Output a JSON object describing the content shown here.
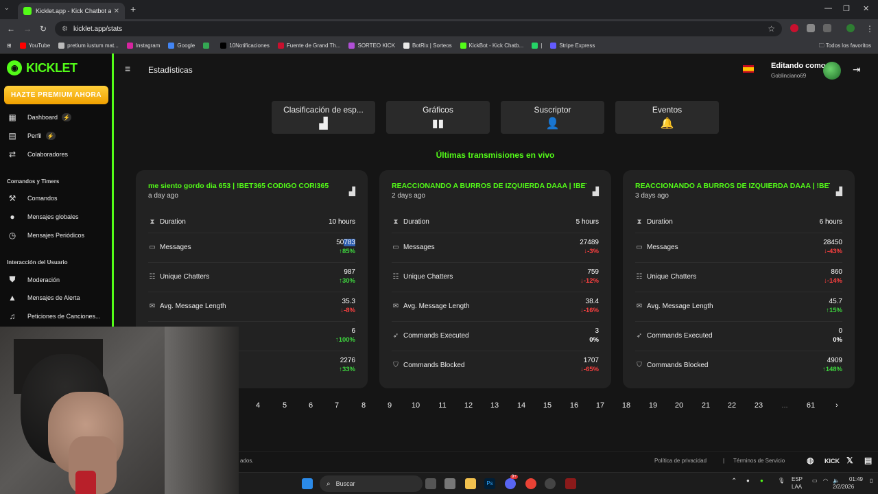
{
  "browser": {
    "tab_title": "Kicklet.app - Kick Chatbot and",
    "url": "kicklet.app/stats",
    "bookmarks": [
      {
        "label": "YouTube",
        "color": "#ff0000"
      },
      {
        "label": "pretium iustum mat...",
        "color": "#bbbbbb"
      },
      {
        "label": "Instagram",
        "color": "#d6249f"
      },
      {
        "label": "Google",
        "color": "#4285f4"
      },
      {
        "label": "",
        "color": "#34a853"
      },
      {
        "label": "10Notificaciones",
        "color": "#000000"
      },
      {
        "label": "Fuente de Grand Th...",
        "color": "#c8102e"
      },
      {
        "label": "SORTEO KICK",
        "color": "#b04fd6"
      },
      {
        "label": "BotRix | Sorteos",
        "color": "#e8e8e8"
      },
      {
        "label": "KickBot - Kick Chatb...",
        "color": "#53fc18"
      },
      {
        "label": "|",
        "color": "#25d366"
      },
      {
        "label": "Stripe Express",
        "color": "#635bff"
      }
    ],
    "all_bookmarks": "Todos los favoritos"
  },
  "brand": {
    "name": "KICKLET",
    "accent": "#53fc18",
    "premium_label": "HAZTE PREMIUM AHORA"
  },
  "sidebar": {
    "items_top": [
      {
        "label": "Dashboard",
        "icon": "dashboard-icon",
        "bolt": true
      },
      {
        "label": "Perfil",
        "icon": "profile-icon",
        "bolt": true
      },
      {
        "label": "Colaboradores",
        "icon": "collaborators-icon",
        "bolt": false
      }
    ],
    "section1": "Comandos y Timers",
    "items_mid": [
      {
        "label": "Comandos",
        "icon": "commands-icon"
      },
      {
        "label": "Mensajes globales",
        "icon": "chat-icon"
      },
      {
        "label": "Mensajes Periódicos",
        "icon": "clock-icon"
      }
    ],
    "section2": "Interacción del Usuario",
    "items_bottom": [
      {
        "label": "Moderación",
        "icon": "shield-icon"
      },
      {
        "label": "Mensajes de Alerta",
        "icon": "alert-icon"
      },
      {
        "label": "Peticiones de Canciones...",
        "icon": "music-icon"
      }
    ]
  },
  "header": {
    "title": "Estadísticas",
    "editing_label": "Editando como",
    "username": "Goblinciano69"
  },
  "tabs": [
    {
      "label": "Clasificación de esp...",
      "icon": "ranking-icon"
    },
    {
      "label": "Gráficos",
      "icon": "chart-icon"
    },
    {
      "label": "Suscriptor",
      "icon": "subscriber-icon"
    },
    {
      "label": "Eventos",
      "icon": "bell-icon"
    }
  ],
  "section_title": "Últimas transmisiones en vivo",
  "cards": [
    {
      "title": "me siento gordo dia 653 | !BET365 CODIGO CORI365",
      "ago": "a day ago",
      "duration": "10 hours",
      "messages": "50783",
      "messages_change": "85%",
      "messages_dir": "up",
      "chatters": "987",
      "chatters_change": "30%",
      "chatters_dir": "up",
      "avg_len": "35.3",
      "avg_len_change": "-8%",
      "avg_len_dir": "down",
      "cmd_exec": "6",
      "cmd_exec_change": "100%",
      "cmd_exec_dir": "up",
      "cmd_block": "2276",
      "cmd_block_change": "33%",
      "cmd_block_dir": "up"
    },
    {
      "title": "REACCIONANDO A BURROS DE IZQUIERDA DAAA | !BET365",
      "ago": "2 days ago",
      "duration": "5 hours",
      "messages": "27489",
      "messages_change": "-3%",
      "messages_dir": "down",
      "chatters": "759",
      "chatters_change": "-12%",
      "chatters_dir": "down",
      "avg_len": "38.4",
      "avg_len_change": "-16%",
      "avg_len_dir": "down",
      "cmd_exec": "3",
      "cmd_exec_change": "0%",
      "cmd_exec_dir": "flat",
      "cmd_block": "1707",
      "cmd_block_change": "-65%",
      "cmd_block_dir": "down"
    },
    {
      "title": "REACCIONANDO A BURROS DE IZQUIERDA DAAA | !BET365",
      "ago": "3 days ago",
      "duration": "6 hours",
      "messages": "28450",
      "messages_change": "-43%",
      "messages_dir": "down",
      "chatters": "860",
      "chatters_change": "-14%",
      "chatters_dir": "down",
      "avg_len": "45.7",
      "avg_len_change": "15%",
      "avg_len_dir": "up",
      "cmd_exec": "0",
      "cmd_exec_change": "0%",
      "cmd_exec_dir": "flat",
      "cmd_block": "4909",
      "cmd_block_change": "148%",
      "cmd_block_dir": "up"
    }
  ],
  "metric_labels": {
    "duration": "Duration",
    "messages": "Messages",
    "chatters": "Unique Chatters",
    "avg_len": "Avg. Message Length",
    "cmd_exec": "Commands Executed",
    "cmd_block": "Commands Blocked"
  },
  "pagination": [
    "4",
    "5",
    "6",
    "7",
    "8",
    "9",
    "10",
    "11",
    "12",
    "13",
    "14",
    "15",
    "16",
    "17",
    "18",
    "19",
    "20",
    "21",
    "22",
    "23",
    "...",
    "61",
    "›"
  ],
  "footer": {
    "copyright_tail": "ados.",
    "privacy": "Política de privacidad",
    "terms": "Términos de Servicio",
    "sep": "|"
  },
  "taskbar": {
    "search_placeholder": "Buscar",
    "lang": "ESP",
    "region": "LAA",
    "time": "01:49",
    "date": "2/2/2026",
    "discord_badge": "9+"
  }
}
